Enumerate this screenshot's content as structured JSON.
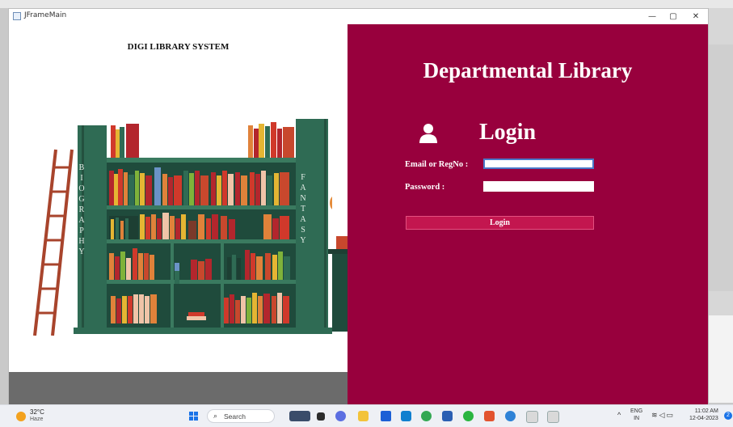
{
  "window": {
    "title": "JFrameMain",
    "minimize_glyph": "—",
    "maximize_glyph": "▢",
    "close_glyph": "✕"
  },
  "left": {
    "app_title": "DIGI LIBRARY SYSTEM",
    "left_shelf_vertical_text": "BIOGRAPHY",
    "right_shelf_vertical_text": "FANTASY"
  },
  "right": {
    "department_title": "Departmental Library",
    "login_heading": "Login",
    "email_label": "Email or RegNo :",
    "email_value": "",
    "password_label": "Password :",
    "password_value": "",
    "login_button_label": "Login",
    "accent_color": "#98003d"
  },
  "taskbar": {
    "temperature": "32°C",
    "weather": "Haze",
    "search_placeholder": "Search",
    "search_glyph": "⌕",
    "tray_caret": "^",
    "language": "ENG",
    "region": "IN",
    "tray_icons": "wifi-icon volume-icon battery-icon",
    "time": "11:02 AM",
    "date": "12-04-2023",
    "notification_count": "2"
  }
}
